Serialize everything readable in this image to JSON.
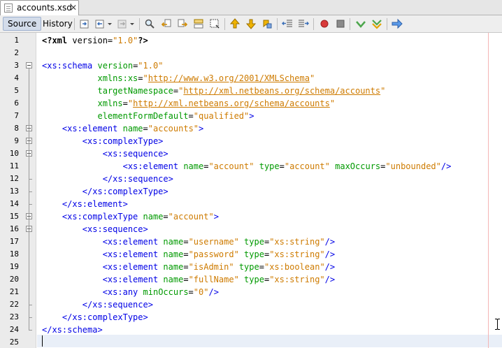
{
  "tab": {
    "title": "accounts.xsd",
    "close": "✕"
  },
  "toolbar": {
    "source_label": "Source",
    "history_label": "History",
    "icons": [
      "last-edit-icon",
      "back-icon",
      "forward-icon",
      "find-icon",
      "find-previous-icon",
      "find-next-icon",
      "find-selection-icon",
      "toggle-highlight-icon",
      "previous-bookmark-icon",
      "next-bookmark-icon",
      "toggle-bookmark-icon",
      "shift-left-icon",
      "shift-right-icon",
      "start-macro-icon",
      "stop-macro-icon",
      "check-xml-icon",
      "validate-xml-icon",
      "run-icon"
    ],
    "colors": {
      "record": "#d83a3a",
      "check": "#4ca64c",
      "run": "#3d7bd6"
    }
  },
  "editor": {
    "line_numbers": [
      "1",
      "2",
      "3",
      "4",
      "5",
      "6",
      "7",
      "8",
      "9",
      "10",
      "11",
      "12",
      "13",
      "14",
      "15",
      "16",
      "17",
      "18",
      "19",
      "20",
      "21",
      "22",
      "23",
      "24",
      "25"
    ],
    "lines": [
      [
        {
          "c": "pi",
          "t": "<?xml"
        },
        {
          "c": "",
          "t": " version="
        },
        {
          "c": "vl",
          "t": "\"1.0\""
        },
        {
          "c": "pi",
          "t": "?>"
        }
      ],
      [],
      [
        {
          "c": "tg",
          "t": "<xs:schema"
        },
        {
          "c": "",
          "t": " "
        },
        {
          "c": "at",
          "t": "version"
        },
        {
          "c": "",
          "t": "="
        },
        {
          "c": "vl",
          "t": "\"1.0\""
        }
      ],
      [
        {
          "c": "",
          "t": "           "
        },
        {
          "c": "at",
          "t": "xmlns:xs"
        },
        {
          "c": "",
          "t": "="
        },
        {
          "c": "vl",
          "t": "\""
        },
        {
          "c": "ln",
          "t": "http://www.w3.org/2001/XMLSchema"
        },
        {
          "c": "vl",
          "t": "\""
        }
      ],
      [
        {
          "c": "",
          "t": "           "
        },
        {
          "c": "at",
          "t": "targetNamespace"
        },
        {
          "c": "",
          "t": "="
        },
        {
          "c": "vl",
          "t": "\""
        },
        {
          "c": "ln",
          "t": "http://xml.netbeans.org/schema/accounts"
        },
        {
          "c": "vl",
          "t": "\""
        }
      ],
      [
        {
          "c": "",
          "t": "           "
        },
        {
          "c": "at",
          "t": "xmlns"
        },
        {
          "c": "",
          "t": "="
        },
        {
          "c": "vl",
          "t": "\""
        },
        {
          "c": "ln",
          "t": "http://xml.netbeans.org/schema/accounts"
        },
        {
          "c": "vl",
          "t": "\""
        }
      ],
      [
        {
          "c": "",
          "t": "           "
        },
        {
          "c": "at",
          "t": "elementFormDefault"
        },
        {
          "c": "",
          "t": "="
        },
        {
          "c": "vl",
          "t": "\"qualified\""
        },
        {
          "c": "tg",
          "t": ">"
        }
      ],
      [
        {
          "c": "",
          "t": "    "
        },
        {
          "c": "tg",
          "t": "<xs:element"
        },
        {
          "c": "",
          "t": " "
        },
        {
          "c": "at",
          "t": "name"
        },
        {
          "c": "",
          "t": "="
        },
        {
          "c": "vl",
          "t": "\"accounts\""
        },
        {
          "c": "tg",
          "t": ">"
        }
      ],
      [
        {
          "c": "",
          "t": "        "
        },
        {
          "c": "tg",
          "t": "<xs:complexType>"
        }
      ],
      [
        {
          "c": "",
          "t": "            "
        },
        {
          "c": "tg",
          "t": "<xs:sequence>"
        }
      ],
      [
        {
          "c": "",
          "t": "                "
        },
        {
          "c": "tg",
          "t": "<xs:element"
        },
        {
          "c": "",
          "t": " "
        },
        {
          "c": "at",
          "t": "name"
        },
        {
          "c": "",
          "t": "="
        },
        {
          "c": "vl",
          "t": "\"account\""
        },
        {
          "c": "",
          "t": " "
        },
        {
          "c": "at",
          "t": "type"
        },
        {
          "c": "",
          "t": "="
        },
        {
          "c": "vl",
          "t": "\"account\""
        },
        {
          "c": "",
          "t": " "
        },
        {
          "c": "at",
          "t": "maxOccurs"
        },
        {
          "c": "",
          "t": "="
        },
        {
          "c": "vl",
          "t": "\"unbounded\""
        },
        {
          "c": "tg",
          "t": "/>"
        }
      ],
      [
        {
          "c": "",
          "t": "            "
        },
        {
          "c": "tg",
          "t": "</xs:sequence>"
        }
      ],
      [
        {
          "c": "",
          "t": "        "
        },
        {
          "c": "tg",
          "t": "</xs:complexType>"
        }
      ],
      [
        {
          "c": "",
          "t": "    "
        },
        {
          "c": "tg",
          "t": "</xs:element>"
        }
      ],
      [
        {
          "c": "",
          "t": "    "
        },
        {
          "c": "tg",
          "t": "<xs:complexType"
        },
        {
          "c": "",
          "t": " "
        },
        {
          "c": "at",
          "t": "name"
        },
        {
          "c": "",
          "t": "="
        },
        {
          "c": "vl",
          "t": "\"account\""
        },
        {
          "c": "tg",
          "t": ">"
        }
      ],
      [
        {
          "c": "",
          "t": "        "
        },
        {
          "c": "tg",
          "t": "<xs:sequence>"
        }
      ],
      [
        {
          "c": "",
          "t": "            "
        },
        {
          "c": "tg",
          "t": "<xs:element"
        },
        {
          "c": "",
          "t": " "
        },
        {
          "c": "at",
          "t": "name"
        },
        {
          "c": "",
          "t": "="
        },
        {
          "c": "vl",
          "t": "\"username\""
        },
        {
          "c": "",
          "t": " "
        },
        {
          "c": "at",
          "t": "type"
        },
        {
          "c": "",
          "t": "="
        },
        {
          "c": "vl",
          "t": "\"xs:string\""
        },
        {
          "c": "tg",
          "t": "/>"
        }
      ],
      [
        {
          "c": "",
          "t": "            "
        },
        {
          "c": "tg",
          "t": "<xs:element"
        },
        {
          "c": "",
          "t": " "
        },
        {
          "c": "at",
          "t": "name"
        },
        {
          "c": "",
          "t": "="
        },
        {
          "c": "vl",
          "t": "\"password\""
        },
        {
          "c": "",
          "t": " "
        },
        {
          "c": "at",
          "t": "type"
        },
        {
          "c": "",
          "t": "="
        },
        {
          "c": "vl",
          "t": "\"xs:string\""
        },
        {
          "c": "tg",
          "t": "/>"
        }
      ],
      [
        {
          "c": "",
          "t": "            "
        },
        {
          "c": "tg",
          "t": "<xs:element"
        },
        {
          "c": "",
          "t": " "
        },
        {
          "c": "at",
          "t": "name"
        },
        {
          "c": "",
          "t": "="
        },
        {
          "c": "vl",
          "t": "\"isAdmin\""
        },
        {
          "c": "",
          "t": " "
        },
        {
          "c": "at",
          "t": "type"
        },
        {
          "c": "",
          "t": "="
        },
        {
          "c": "vl",
          "t": "\"xs:boolean\""
        },
        {
          "c": "tg",
          "t": "/>"
        }
      ],
      [
        {
          "c": "",
          "t": "            "
        },
        {
          "c": "tg",
          "t": "<xs:element"
        },
        {
          "c": "",
          "t": " "
        },
        {
          "c": "at",
          "t": "name"
        },
        {
          "c": "",
          "t": "="
        },
        {
          "c": "vl",
          "t": "\"fullName\""
        },
        {
          "c": "",
          "t": " "
        },
        {
          "c": "at",
          "t": "type"
        },
        {
          "c": "",
          "t": "="
        },
        {
          "c": "vl",
          "t": "\"xs:string\""
        },
        {
          "c": "tg",
          "t": "/>"
        }
      ],
      [
        {
          "c": "",
          "t": "            "
        },
        {
          "c": "tg",
          "t": "<xs:any"
        },
        {
          "c": "",
          "t": " "
        },
        {
          "c": "at",
          "t": "minOccurs"
        },
        {
          "c": "",
          "t": "="
        },
        {
          "c": "vl",
          "t": "\"0\""
        },
        {
          "c": "tg",
          "t": "/>"
        }
      ],
      [
        {
          "c": "",
          "t": "        "
        },
        {
          "c": "tg",
          "t": "</xs:sequence>"
        }
      ],
      [
        {
          "c": "",
          "t": "    "
        },
        {
          "c": "tg",
          "t": "</xs:complexType>"
        }
      ],
      [
        {
          "c": "tg",
          "t": "</xs:schema>"
        }
      ],
      []
    ]
  }
}
